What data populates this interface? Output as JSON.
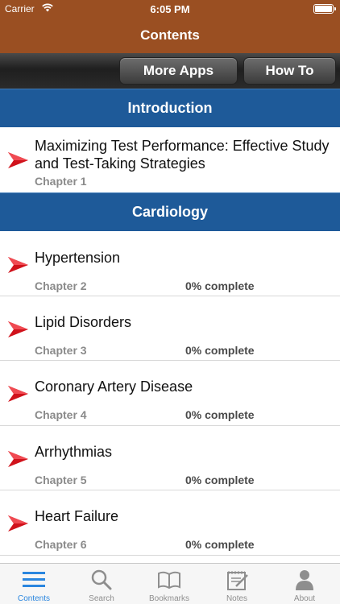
{
  "status": {
    "carrier": "Carrier",
    "time": "6:05 PM"
  },
  "nav": {
    "title": "Contents"
  },
  "toolbar": {
    "more_apps": "More Apps",
    "how_to": "How To"
  },
  "sections": [
    {
      "title": "Introduction",
      "rows": [
        {
          "title": "Maximizing Test Performance: Effective Study and Test-Taking Strategies",
          "chapter": "Chapter 1",
          "progress": ""
        }
      ]
    },
    {
      "title": "Cardiology",
      "rows": [
        {
          "title": "Hypertension",
          "chapter": "Chapter 2",
          "progress": "0% complete"
        },
        {
          "title": "Lipid Disorders",
          "chapter": "Chapter 3",
          "progress": "0% complete"
        },
        {
          "title": "Coronary Artery Disease",
          "chapter": "Chapter 4",
          "progress": "0% complete"
        },
        {
          "title": "Arrhythmias",
          "chapter": "Chapter 5",
          "progress": "0% complete"
        },
        {
          "title": "Heart Failure",
          "chapter": "Chapter 6",
          "progress": "0% complete"
        }
      ]
    }
  ],
  "tabs": [
    {
      "label": "Contents",
      "icon": "list-icon",
      "active": true
    },
    {
      "label": "Search",
      "icon": "search-icon",
      "active": false
    },
    {
      "label": "Bookmarks",
      "icon": "book-icon",
      "active": false
    },
    {
      "label": "Notes",
      "icon": "notepad-icon",
      "active": false
    },
    {
      "label": "About",
      "icon": "person-icon",
      "active": false
    }
  ],
  "colors": {
    "nav": "#9a4f22",
    "section": "#1e5a99",
    "arrow": "#d0121b",
    "tab_active": "#2a86df"
  }
}
